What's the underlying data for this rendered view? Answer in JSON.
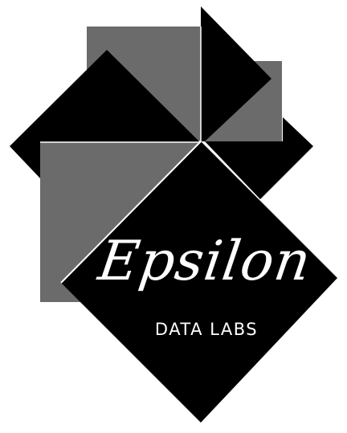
{
  "logo": {
    "name": "Epsilon",
    "tagline": "DATA LABS",
    "colors": {
      "black": "#000000",
      "gray": "#6b6b6b",
      "white": "#ffffff"
    }
  }
}
